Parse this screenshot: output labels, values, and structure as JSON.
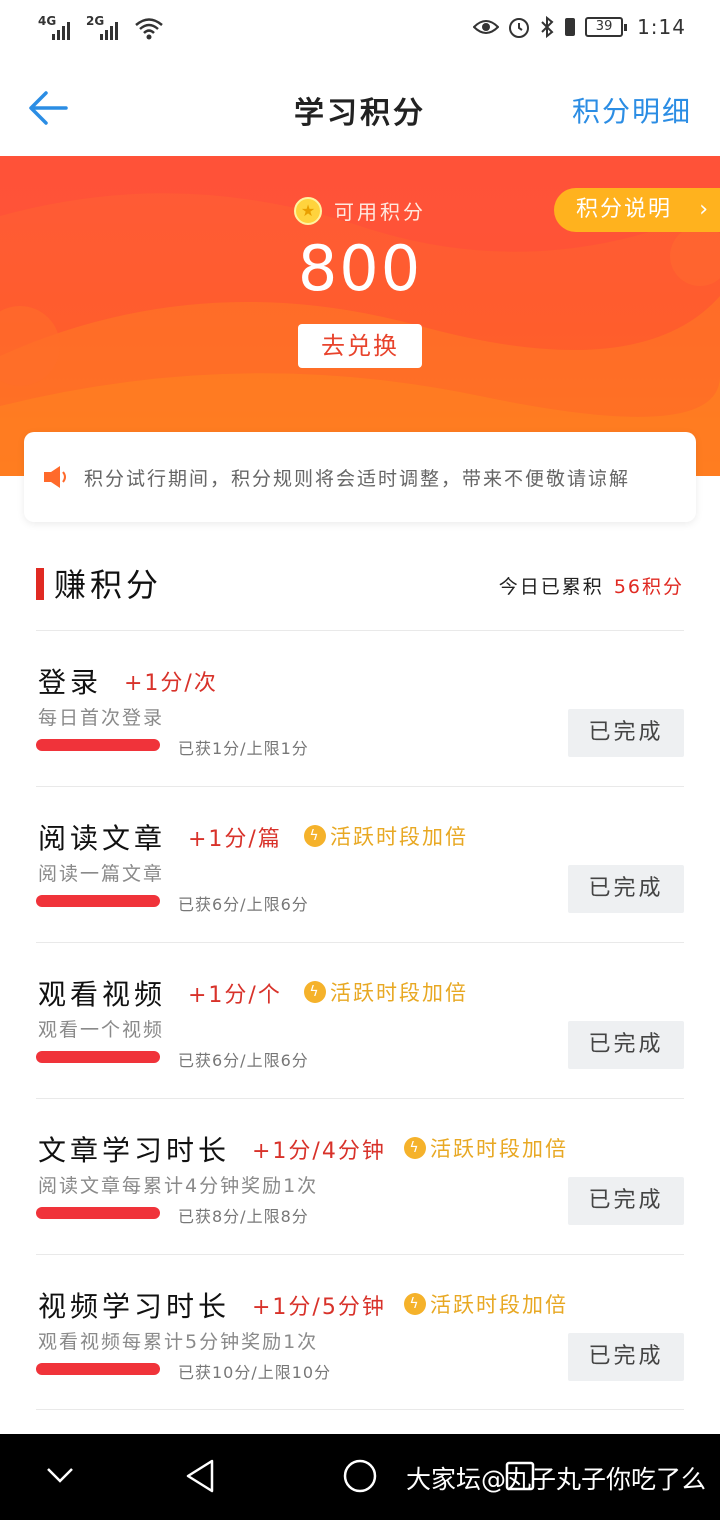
{
  "status_bar": {
    "signal1": "4G",
    "signal2": "2G",
    "battery": "39",
    "time": "1:14",
    "icons": [
      "eye-icon",
      "alarm-icon",
      "bluetooth-icon",
      "battery-icon"
    ]
  },
  "nav": {
    "title": "学习积分",
    "right_link": "积分明细",
    "back_icon": "arrow-left-icon",
    "accent": "#2b8de4"
  },
  "hero": {
    "available_label": "可用积分",
    "points": "800",
    "redeem_label": "去兑换",
    "explain_label": "积分说明",
    "explain_chevron": "›",
    "colors": {
      "bg": "#ff5d2c",
      "explain_bg": "#ffb21e"
    }
  },
  "notice": {
    "text": "积分试行期间，积分规则将会适时调整，带来不便敬请谅解",
    "icon": "speaker-icon"
  },
  "earn": {
    "title": "赚积分",
    "today_label": "今日已累积",
    "today_value": "56积分",
    "accent": "#e02a22"
  },
  "tasks": [
    {
      "title": "登录",
      "rate": "+1分/次",
      "boost": "",
      "desc": "每日首次登录",
      "progress_text": "已获1分/上限1分",
      "progress": 1.0,
      "button": "已完成"
    },
    {
      "title": "阅读文章",
      "rate": "+1分/篇",
      "boost": "活跃时段加倍",
      "desc": "阅读一篇文章",
      "progress_text": "已获6分/上限6分",
      "progress": 1.0,
      "button": "已完成"
    },
    {
      "title": "观看视频",
      "rate": "+1分/个",
      "boost": "活跃时段加倍",
      "desc": "观看一个视频",
      "progress_text": "已获6分/上限6分",
      "progress": 1.0,
      "button": "已完成"
    },
    {
      "title": "文章学习时长",
      "rate": "+1分/4分钟",
      "boost": "活跃时段加倍",
      "desc": "阅读文章每累计4分钟奖励1次",
      "progress_text": "已获8分/上限8分",
      "progress": 1.0,
      "button": "已完成"
    },
    {
      "title": "视频学习时长",
      "rate": "+1分/5分钟",
      "boost": "活跃时段加倍",
      "desc": "观看视频每累计5分钟奖励1次",
      "progress_text": "已获10分/上限10分",
      "progress": 1.0,
      "button": "已完成"
    }
  ],
  "bottom_nav": {
    "icons": [
      "chevron-down-icon",
      "back-triangle-icon",
      "home-circle-icon",
      "recents-square-icon"
    ],
    "watermark": "大家坛@丸子丸子你吃了么"
  }
}
